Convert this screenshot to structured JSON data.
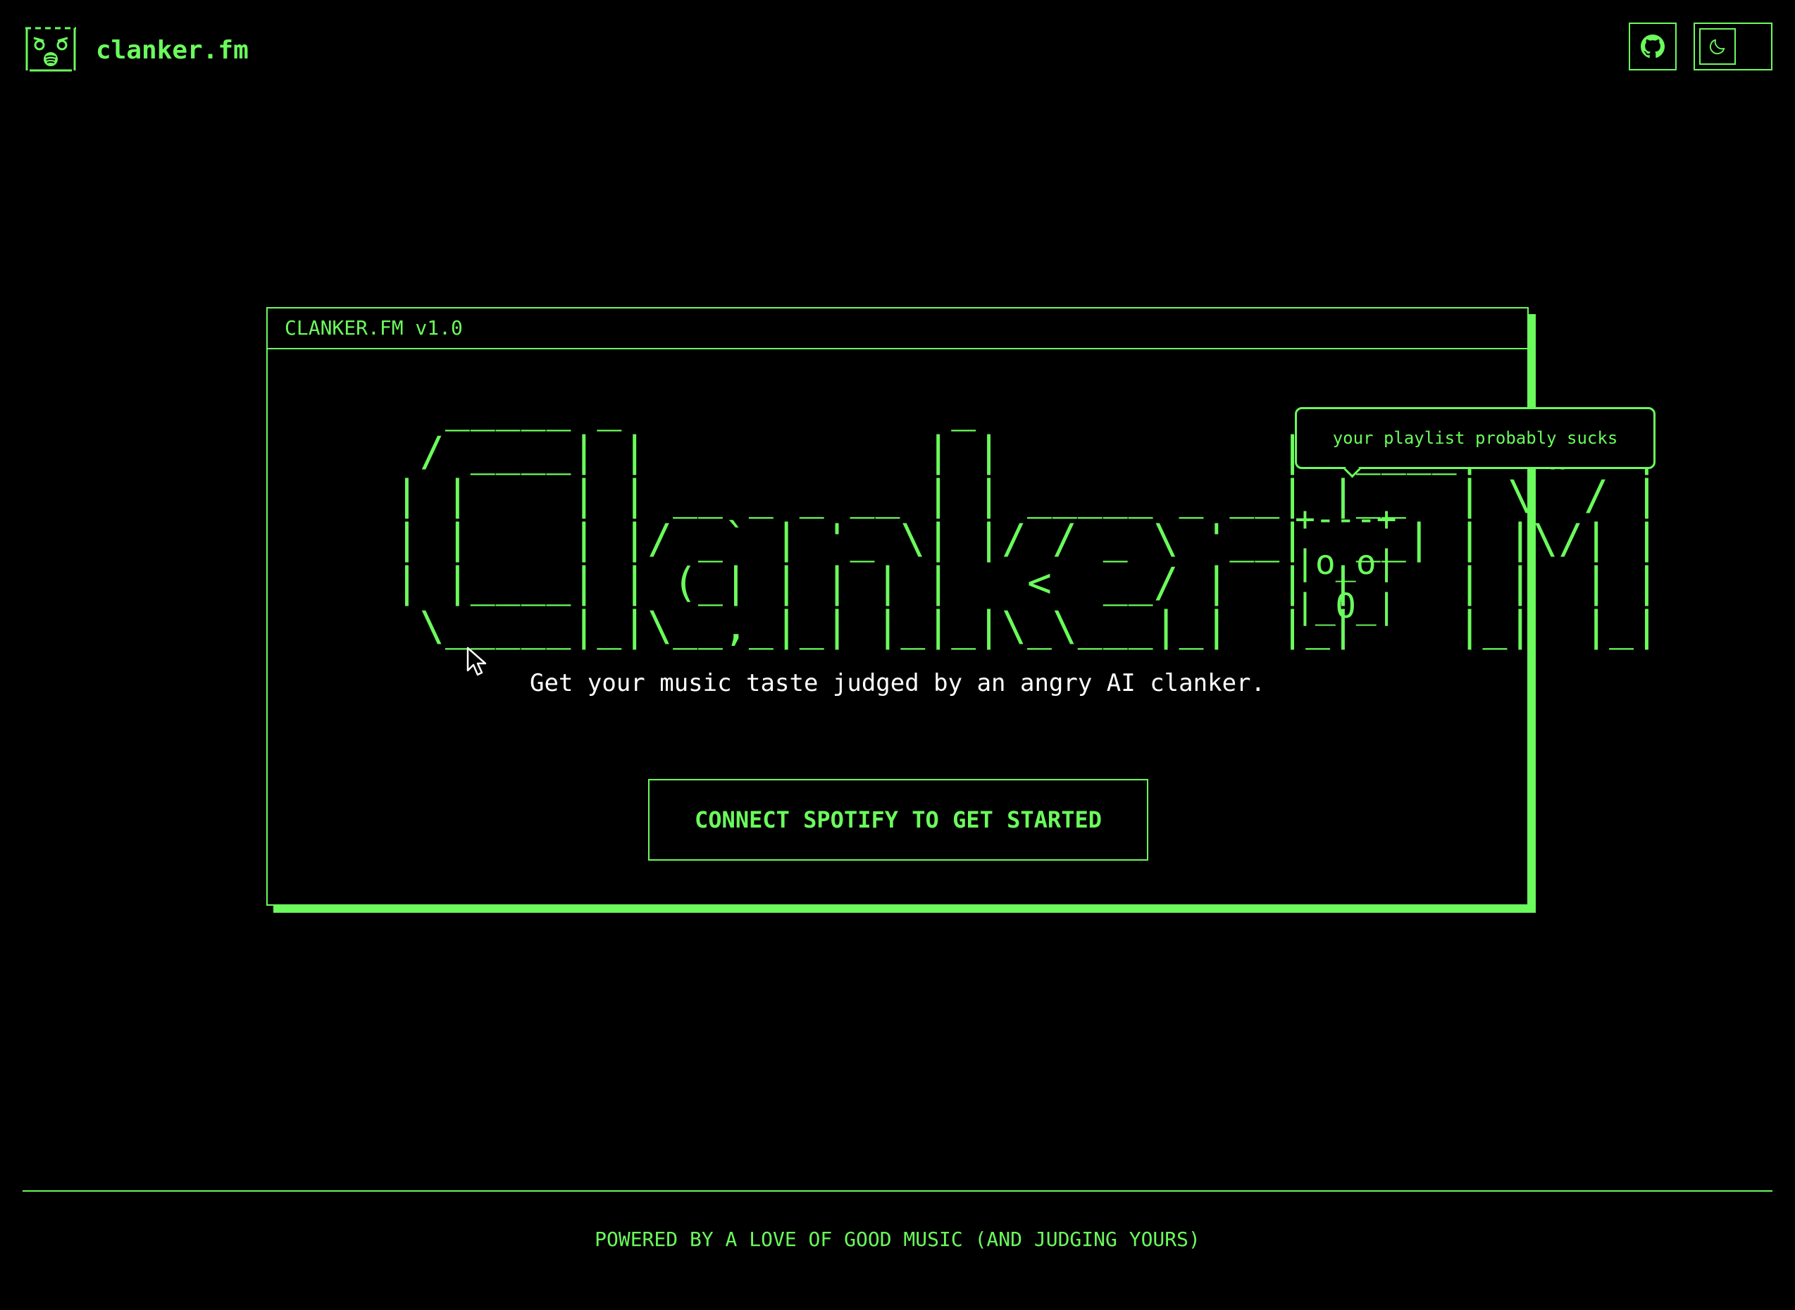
{
  "header": {
    "brand": "clanker.fm",
    "github_icon": "github-icon",
    "theme_icon": "moon-icon"
  },
  "window": {
    "title": "CLANKER.FM v1.0",
    "ascii_logo": "  _____ _             _             ______ __  __ \n / ____| |           | |           |  ____|  \\/  |\n| |    | | __ _ _ __ | | _____ _ __| |__  | \\  / |\n| |    | |/ _` | '_ \\| |/ / _ \\ '__|  __| | |\\/| |\n| |____| | (_| | | | |   <  __/ |  | |    | |  | |\n \\_____|_|\\__,_|_| |_|_|\\_\\___|_|  |_|    |_|  |_|",
    "robot": "+---+\n|o_o|\n|_O_|",
    "speech": "your playlist probably sucks",
    "tagline": "Get your music taste judged by an angry AI clanker.",
    "cta": "CONNECT SPOTIFY TO GET STARTED"
  },
  "footer": {
    "text": "POWERED BY A LOVE OF GOOD MUSIC (AND JUDGING YOURS)"
  },
  "colors": {
    "accent": "#6bfb5c",
    "background": "#000000",
    "text": "#ffffff"
  }
}
